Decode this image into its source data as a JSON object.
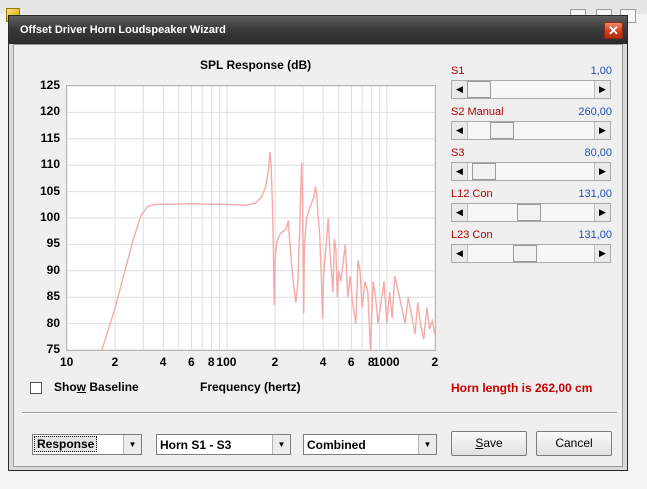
{
  "window": {
    "title": "Offset Driver Horn Loudspeaker Wizard",
    "close_glyph": "✕"
  },
  "chart_data": {
    "type": "line",
    "title": "SPL Response (dB)",
    "xlabel": "Frequency (hertz)",
    "ylabel": "",
    "x_scale": "log",
    "xlim": [
      10,
      2000
    ],
    "ylim": [
      75,
      125
    ],
    "y_ticks": [
      "125",
      "120",
      "115",
      "110",
      "105",
      "100",
      "95",
      "90",
      "85",
      "80",
      "75"
    ],
    "x_ticks": [
      {
        "f": 10,
        "label": "10"
      },
      {
        "f": 20,
        "label": "2"
      },
      {
        "f": 40,
        "label": "4"
      },
      {
        "f": 60,
        "label": "6"
      },
      {
        "f": 80,
        "label": "8"
      },
      {
        "f": 100,
        "label": "100"
      },
      {
        "f": 200,
        "label": "2"
      },
      {
        "f": 400,
        "label": "4"
      },
      {
        "f": 600,
        "label": "6"
      },
      {
        "f": 800,
        "label": "8"
      },
      {
        "f": 1000,
        "label": "1000"
      },
      {
        "f": 2000,
        "label": "2"
      }
    ],
    "grid": true,
    "series_color": "#f4aaa8",
    "series": [
      {
        "name": "",
        "points": [
          [
            16.5,
            75
          ],
          [
            18,
            78.5
          ],
          [
            20,
            83
          ],
          [
            23,
            90
          ],
          [
            26,
            96
          ],
          [
            29,
            100.5
          ],
          [
            32,
            102.2
          ],
          [
            36,
            102.6
          ],
          [
            45,
            102.6
          ],
          [
            60,
            102.7
          ],
          [
            80,
            102.6
          ],
          [
            100,
            102.6
          ],
          [
            130,
            102.4
          ],
          [
            150,
            102.8
          ],
          [
            165,
            104
          ],
          [
            175,
            106
          ],
          [
            182,
            109
          ],
          [
            186,
            112.5
          ],
          [
            189,
            110
          ],
          [
            192,
            104
          ],
          [
            195,
            95
          ],
          [
            197,
            86
          ],
          [
            198,
            83.5
          ],
          [
            200,
            92
          ],
          [
            205,
            95.5
          ],
          [
            215,
            97
          ],
          [
            225,
            97.5
          ],
          [
            235,
            98
          ],
          [
            242,
            99.5
          ],
          [
            248,
            95
          ],
          [
            254,
            91
          ],
          [
            262,
            87
          ],
          [
            270,
            84
          ],
          [
            278,
            88
          ],
          [
            285,
            98
          ],
          [
            290,
            106
          ],
          [
            294,
            110.5
          ],
          [
            297,
            104
          ],
          [
            300,
            90
          ],
          [
            302,
            82
          ],
          [
            305,
            95
          ],
          [
            315,
            100
          ],
          [
            330,
            102
          ],
          [
            350,
            104
          ],
          [
            358,
            106
          ],
          [
            364,
            104.5
          ],
          [
            372,
            100
          ],
          [
            380,
            97
          ],
          [
            385,
            92
          ],
          [
            390,
            88
          ],
          [
            396,
            81
          ],
          [
            402,
            89
          ],
          [
            410,
            92
          ],
          [
            420,
            96
          ],
          [
            430,
            100
          ],
          [
            440,
            94
          ],
          [
            450,
            90
          ],
          [
            460,
            86
          ],
          [
            470,
            96
          ],
          [
            480,
            94
          ],
          [
            490,
            85
          ],
          [
            500,
            90
          ],
          [
            515,
            88
          ],
          [
            530,
            91
          ],
          [
            550,
            95
          ],
          [
            570,
            85
          ],
          [
            590,
            89
          ],
          [
            610,
            84
          ],
          [
            640,
            80
          ],
          [
            660,
            92
          ],
          [
            680,
            90
          ],
          [
            700,
            83
          ],
          [
            730,
            88
          ],
          [
            760,
            86
          ],
          [
            790,
            75
          ],
          [
            820,
            88
          ],
          [
            850,
            85
          ],
          [
            880,
            80
          ],
          [
            920,
            84
          ],
          [
            960,
            88
          ],
          [
            1000,
            80
          ],
          [
            1040,
            86
          ],
          [
            1080,
            81
          ],
          [
            1120,
            89
          ],
          [
            1180,
            86
          ],
          [
            1240,
            83
          ],
          [
            1300,
            80
          ],
          [
            1360,
            85
          ],
          [
            1420,
            82
          ],
          [
            1500,
            78
          ],
          [
            1560,
            84
          ],
          [
            1620,
            80
          ],
          [
            1700,
            77
          ],
          [
            1780,
            83
          ],
          [
            1850,
            79
          ],
          [
            1920,
            80.5
          ],
          [
            2000,
            78
          ]
        ]
      }
    ]
  },
  "show_baseline": {
    "label_pre": "Sho",
    "label_underlined": "w",
    "label_post": " Baseline",
    "checked": false
  },
  "sliders": [
    {
      "label": "S1",
      "value": "1,00",
      "level": 0.0
    },
    {
      "label": "S2  Manual",
      "value": "260,00",
      "level": 0.22
    },
    {
      "label": "S3",
      "value": "80,00",
      "level": 0.05
    },
    {
      "label": "L12  Con",
      "value": "131,00",
      "level": 0.48
    },
    {
      "label": "L23  Con",
      "value": "131,00",
      "level": 0.44
    }
  ],
  "arrows": {
    "left": "◀",
    "right": "▶",
    "dropdown": "▼"
  },
  "horn_length": "Horn length is 262,00 cm",
  "combos": {
    "view": "Response",
    "section": "Horn S1 - S3",
    "mode": "Combined"
  },
  "buttons": {
    "save_underlined": "S",
    "save_rest": "ave",
    "cancel": "Cancel"
  }
}
